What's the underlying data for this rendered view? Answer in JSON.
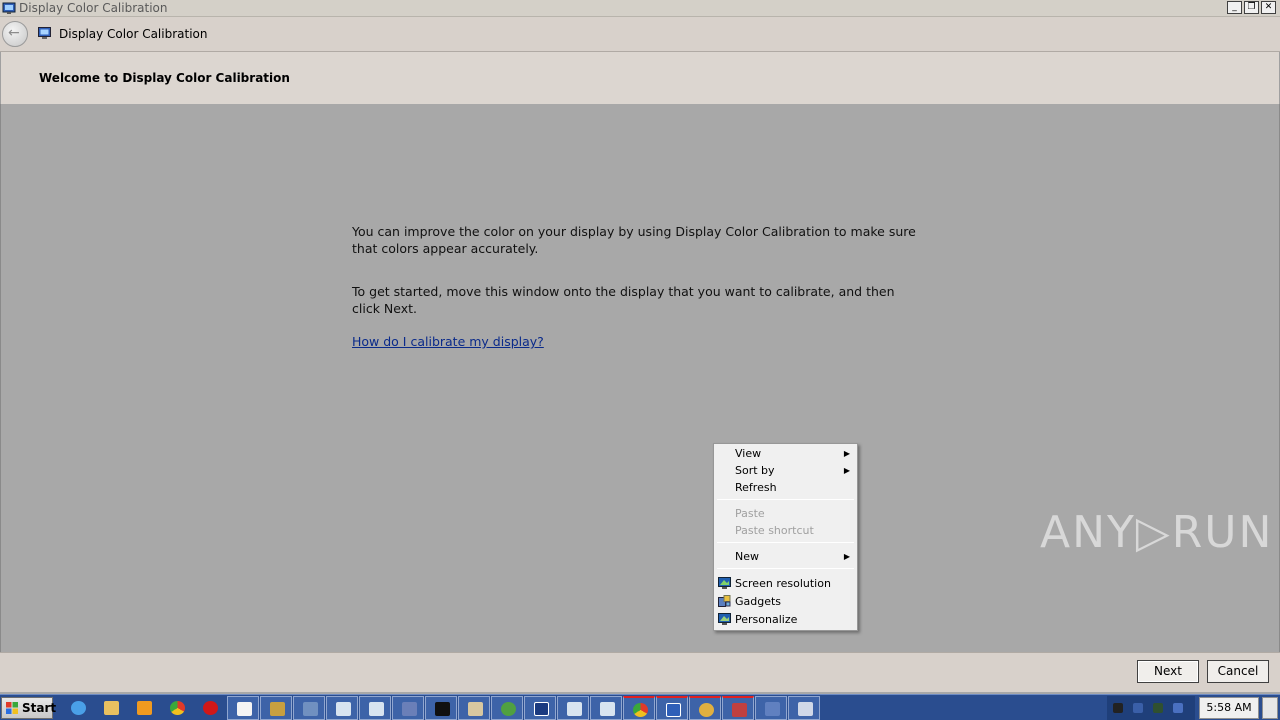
{
  "window": {
    "title": "Display Color Calibration",
    "buttons": {
      "minimize": "_",
      "restore": "❐",
      "close": "✕"
    }
  },
  "nav": {
    "back_icon": "back-arrow-icon",
    "title": "Display Color Calibration"
  },
  "page": {
    "heading": "Welcome to Display Color Calibration",
    "paragraph1": "You can improve the color on your display by using Display Color Calibration to make sure that colors appear accurately.",
    "paragraph2": "To get started, move this window onto the display that you want to calibrate, and then click Next.",
    "help_link": "How do I calibrate my display?"
  },
  "footer": {
    "next_label": "Next",
    "cancel_label": "Cancel"
  },
  "context_menu": {
    "items": [
      {
        "label": "View",
        "submenu": true,
        "enabled": true
      },
      {
        "label": "Sort by",
        "submenu": true,
        "enabled": true
      },
      {
        "label": "Refresh",
        "submenu": false,
        "enabled": true
      },
      {
        "label": "Paste",
        "submenu": false,
        "enabled": false
      },
      {
        "label": "Paste shortcut",
        "submenu": false,
        "enabled": false
      },
      {
        "label": "New",
        "submenu": true,
        "enabled": true
      },
      {
        "label": "Screen resolution",
        "icon": "screen-resolution-icon",
        "enabled": true
      },
      {
        "label": "Gadgets",
        "icon": "gadgets-icon",
        "enabled": true
      },
      {
        "label": "Personalize",
        "icon": "personalize-icon",
        "enabled": true
      }
    ],
    "submenu_arrow": "▶"
  },
  "watermark": "ANY▷RUN",
  "taskbar": {
    "start_label": "Start",
    "clock": "5:58 AM",
    "items": [
      "internet-explorer-icon",
      "explorer-folder-icon",
      "media-player-icon",
      "chrome-icon",
      "opera-icon",
      "notepad-icon",
      "registry-icon",
      "network-icon",
      "window-icon",
      "window-icon",
      "tool-icon",
      "cmd-icon",
      "printer-icon",
      "flower-icon",
      "display-icon",
      "window-icon",
      "window-icon",
      "chrome-icon",
      "display-calibration-icon",
      "search-icon",
      "text-tool-icon",
      "user-icon",
      "control-panel-icon"
    ]
  },
  "colors": {
    "window_bg": "#a8a8a8",
    "header_bg": "#dcd6d0",
    "link": "#0a2a8a",
    "taskbar": "#2a4d8f"
  }
}
